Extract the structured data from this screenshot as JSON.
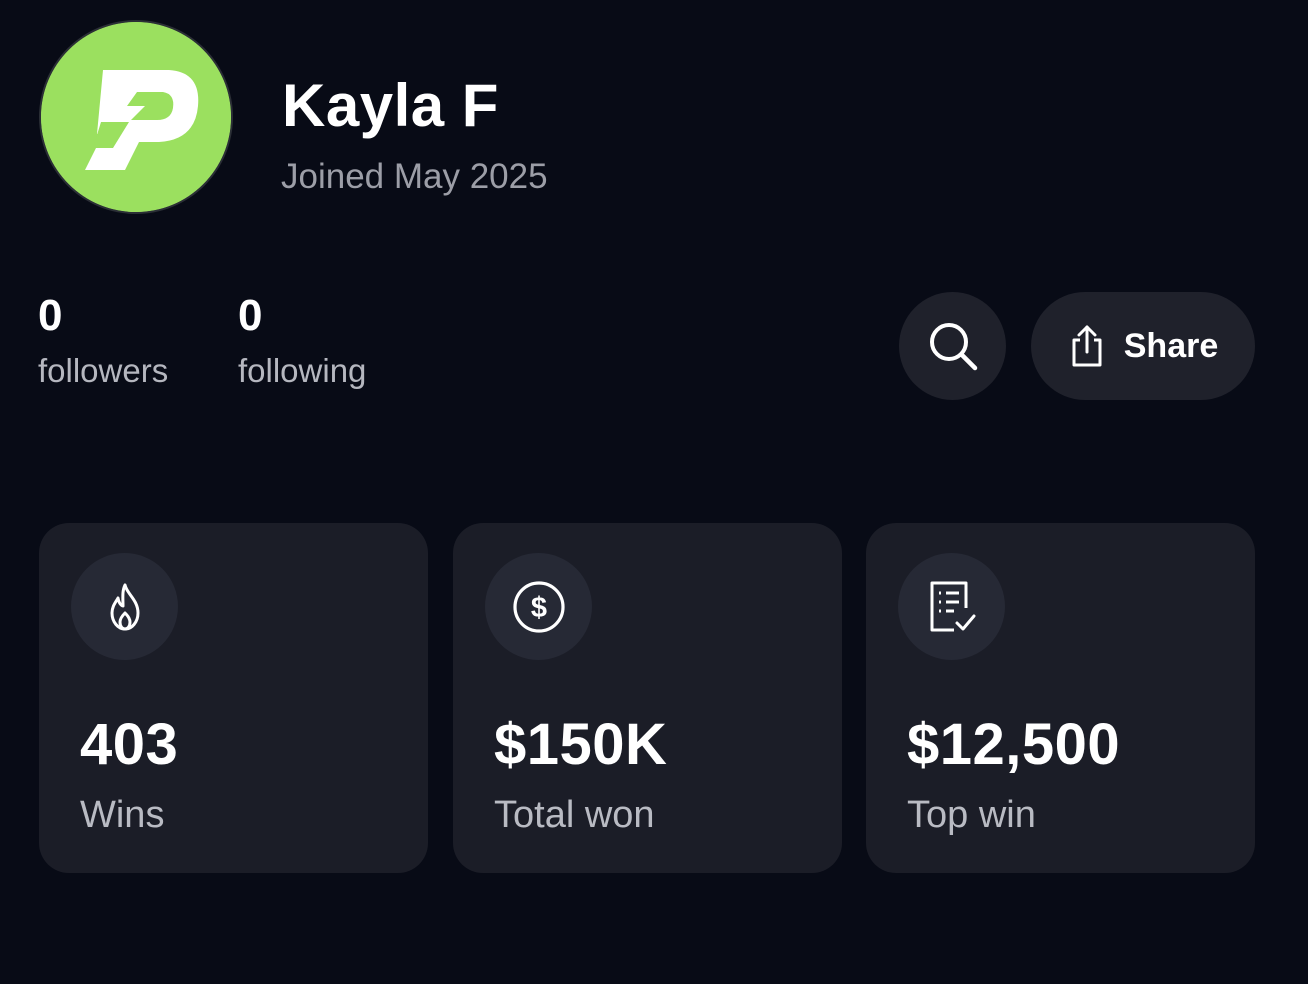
{
  "profile": {
    "name": "Kayla F",
    "joined": "Joined May 2025",
    "avatar_icon": "brand-logo-icon",
    "avatar_color": "#9be05f"
  },
  "social": {
    "followers_count": "0",
    "followers_label": "followers",
    "following_count": "0",
    "following_label": "following"
  },
  "actions": {
    "search_icon": "search-icon",
    "share_icon": "share-icon",
    "share_label": "Share"
  },
  "stats": [
    {
      "icon": "flame-icon",
      "value": "403",
      "label": "Wins"
    },
    {
      "icon": "dollar-circle-icon",
      "value": "$150K",
      "label": "Total won"
    },
    {
      "icon": "receipt-check-icon",
      "value": "$12,500",
      "label": "Top win"
    }
  ],
  "colors": {
    "background": "#080b16",
    "card": "#1b1d27",
    "button": "#1f212b",
    "accent": "#9be05f"
  }
}
